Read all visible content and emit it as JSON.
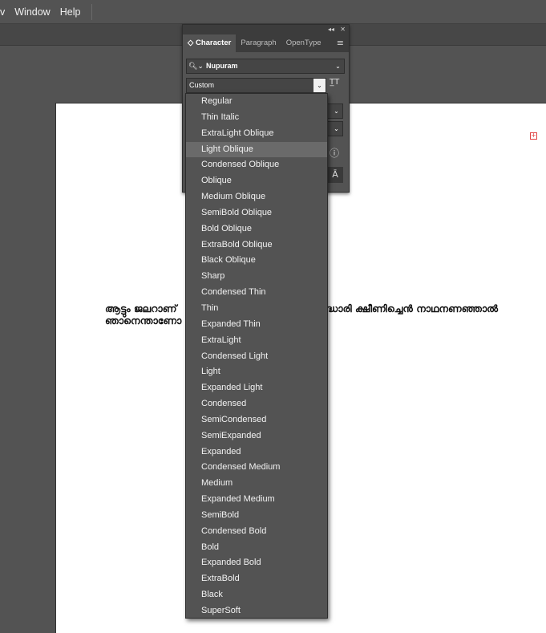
{
  "menubar": {
    "items": [
      "v",
      "Window",
      "Help"
    ]
  },
  "panel": {
    "controls": {
      "collapse": "◂◂",
      "close": "✕"
    },
    "tabs": [
      {
        "label": "Character",
        "prefix": "◇"
      },
      {
        "label": "Paragraph"
      },
      {
        "label": "OpenType"
      }
    ],
    "menu_icon": "≡",
    "font_search_icon": "🔍︎⌄",
    "font_family": "Nupuram",
    "font_style": "Custom",
    "type_icon": "T̲T",
    "info_icon": "ⓘ",
    "glyph_icon": "Ā"
  },
  "dropdown": {
    "highlighted": "Light Oblique",
    "items": [
      "Regular",
      "Thin Italic",
      "ExtraLight Oblique",
      "Light Oblique",
      "Condensed Oblique",
      "Oblique",
      "Medium Oblique",
      "SemiBold Oblique",
      "Bold Oblique",
      "ExtraBold Oblique",
      "Black Oblique",
      "Sharp",
      "Condensed Thin",
      "Thin",
      "Expanded Thin",
      "ExtraLight",
      "Condensed Light",
      "Light",
      "Expanded Light",
      "Condensed",
      "SemiCondensed",
      "SemiExpanded",
      "Expanded",
      "Condensed Medium",
      "Medium",
      "Expanded Medium",
      "SemiBold",
      "Condensed Bold",
      "Bold",
      "Expanded Bold",
      "ExtraBold",
      "Black",
      "SuperSoft"
    ]
  },
  "artboard": {
    "line1_left": "ആട്ടും ജലറാണ്",
    "line1_right": "ദ്ധാരി ക്ഷീണിച്ചെൻ നാഥനണഞ്ഞാൽ",
    "line2_left": "ഞാനെന്താണോ",
    "marker": "+"
  }
}
